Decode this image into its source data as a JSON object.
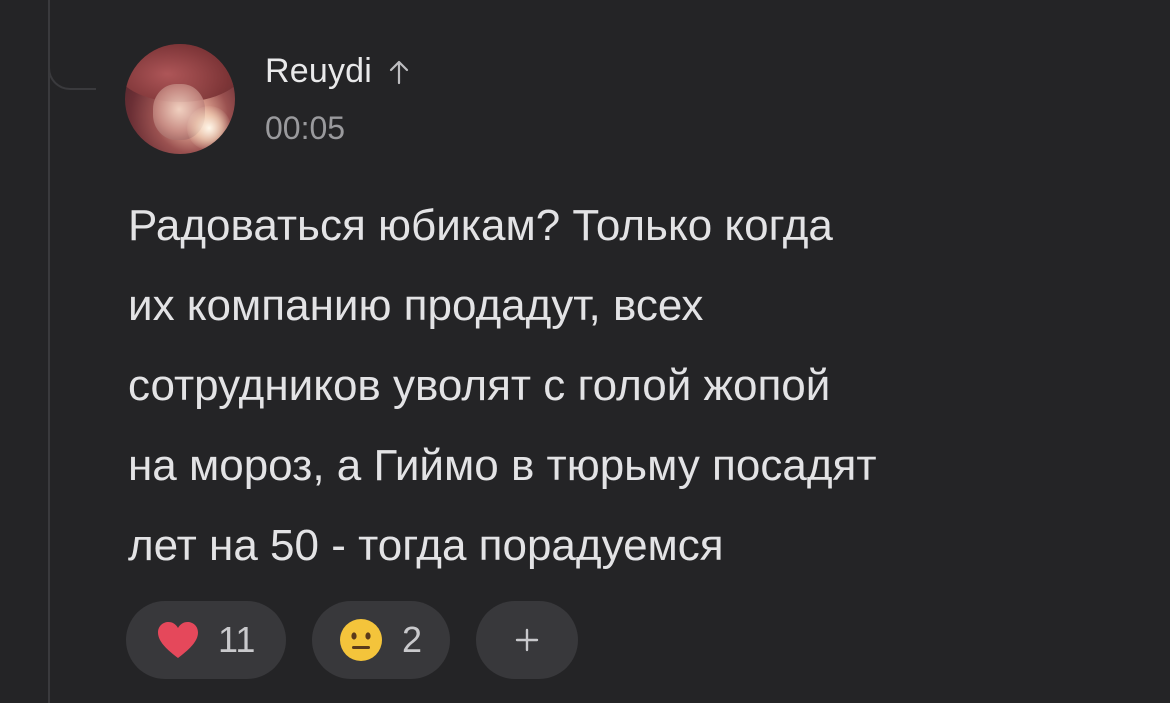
{
  "comment": {
    "author": "Reuydi",
    "timestamp": "00:05",
    "text_lines": [
      "Радоваться юбикам? Только когда",
      "их компанию продадут, всех",
      "сотрудников уволят с голой жопой",
      "на мороз, а Гиймо в тюрьму посадят",
      "лет на 50 - тогда порадуемся"
    ]
  },
  "reactions": {
    "like": {
      "icon": "heart-icon",
      "count": "11",
      "color": "#e5485b"
    },
    "emoji": {
      "icon": "neutral-face-icon",
      "count": "2",
      "color": "#f4c43b"
    },
    "add": {
      "icon": "plus-icon"
    }
  },
  "colors": {
    "background": "#242426",
    "pill": "#38383b",
    "text": "#e3e3e5",
    "muted": "#9a9a9d"
  }
}
